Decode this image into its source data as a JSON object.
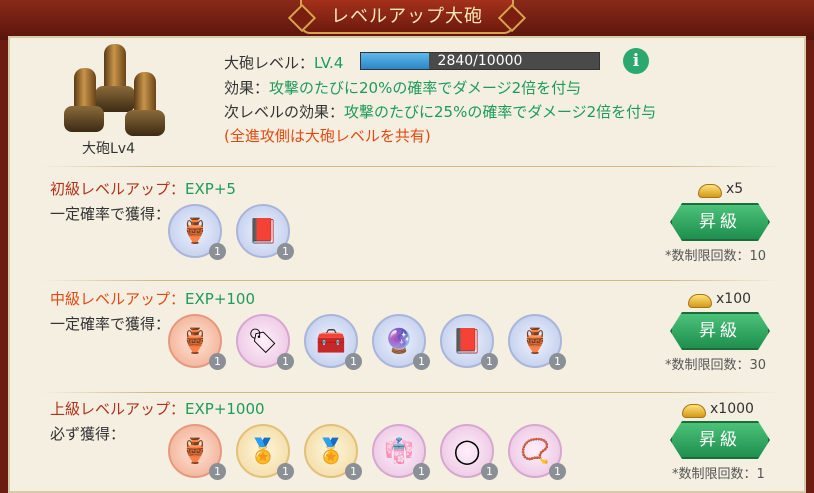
{
  "title": "レベルアップ大砲",
  "cannon": {
    "label": "大砲Lv4",
    "level_label": "大砲レベル：",
    "level_value": "LV.4",
    "progress_text": "2840/10000",
    "progress_fraction": 0.284,
    "effect_label": "効果：",
    "effect_text": "攻撃のたびに20%の確率でダメージ2倍を付与",
    "next_label": "次レベルの効果：",
    "next_text": "攻撃のたびに25%の確率でダメージ2倍を付与",
    "note": "(全進攻側は大砲レベルを共有)",
    "info_icon": "i"
  },
  "tiers": [
    {
      "name": "初級レベルアップ：",
      "exp": "EXP+5",
      "reward_label": "一定確率で獲得：",
      "cost": "x5",
      "button": "昇級",
      "limit": "*数制限回数：10",
      "items": [
        {
          "icon": "gold-statue-icon",
          "glyph": "🏺",
          "qty": "1",
          "bg": "blue"
        },
        {
          "icon": "book-icon",
          "glyph": "📕",
          "qty": "1",
          "bg": "blue"
        }
      ]
    },
    {
      "name": "中級レベルアップ：",
      "exp": "EXP+100",
      "reward_label": "一定確率で獲得：",
      "cost": "x100",
      "button": "昇級",
      "limit": "*数制限回数：30",
      "items": [
        {
          "icon": "gold-statue-icon",
          "glyph": "🏺",
          "qty": "1",
          "bg": "orange-bg"
        },
        {
          "icon": "talisman-icon",
          "glyph": "🏷",
          "qty": "1",
          "bg": "pink"
        },
        {
          "icon": "jade-box-icon",
          "glyph": "🧰",
          "qty": "1",
          "bg": "blue"
        },
        {
          "icon": "crystal-ball-icon",
          "glyph": "🔮",
          "qty": "1",
          "bg": "blue"
        },
        {
          "icon": "book-icon",
          "glyph": "📕",
          "qty": "1",
          "bg": "blue"
        },
        {
          "icon": "gold-statue-icon",
          "glyph": "🏺",
          "qty": "1",
          "bg": "blue"
        }
      ]
    },
    {
      "name": "上級レベルアップ：",
      "exp": "EXP+1000",
      "reward_label": "必ず獲得：",
      "cost": "x1000",
      "button": "昇級",
      "limit": "*数制限回数：1",
      "items": [
        {
          "icon": "gold-statue-icon",
          "glyph": "🏺",
          "qty": "1",
          "bg": "orange-bg"
        },
        {
          "icon": "medal-icon",
          "glyph": "🏅",
          "qty": "1",
          "bg": "gold"
        },
        {
          "icon": "medal-icon",
          "glyph": "🏅",
          "qty": "1",
          "bg": "gold"
        },
        {
          "icon": "robe-icon",
          "glyph": "👘",
          "qty": "1",
          "bg": "pink"
        },
        {
          "icon": "jade-ring-icon",
          "glyph": "◯",
          "qty": "1",
          "bg": "pink"
        },
        {
          "icon": "prayer-beads-icon",
          "glyph": "📿",
          "qty": "1",
          "bg": "pink"
        }
      ]
    }
  ]
}
